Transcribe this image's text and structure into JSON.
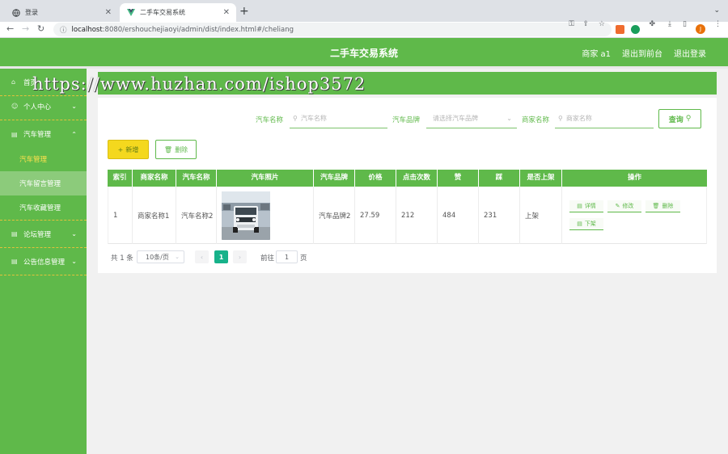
{
  "browser": {
    "tabs": [
      {
        "title": "登录",
        "icon": "globe-icon"
      },
      {
        "title": "二手车交易系统",
        "icon": "vue-logo-icon"
      }
    ],
    "url_host": "localhost",
    "url_path": ":8080/ershouchejiaoyi/admin/dist/index.html#/cheliang",
    "profile_initial": "J"
  },
  "header": {
    "title": "二手车交易系统",
    "nav": [
      "商家 a1",
      "退出到前台",
      "退出登录"
    ]
  },
  "watermark": "https://www.huzhan.com/ishop3572",
  "sidebar": {
    "items": [
      {
        "label": "首页",
        "icon": "home-icon"
      },
      {
        "label": "个人中心",
        "icon": "user-icon"
      },
      {
        "label": "汽车管理",
        "icon": "car-icon"
      },
      {
        "label": "论坛管理",
        "icon": "forum-icon"
      },
      {
        "label": "公告信息管理",
        "icon": "notice-icon"
      }
    ],
    "subitems": [
      "汽车管理",
      "汽车留言管理",
      "汽车收藏管理"
    ]
  },
  "search": {
    "car_name_label": "汽车名称",
    "car_name_placeholder": "汽车名称",
    "brand_label": "汽车品牌",
    "brand_placeholder": "请选择汽车品牌",
    "merchant_label": "商家名称",
    "merchant_placeholder": "商家名称",
    "query_button": "查询"
  },
  "actions": {
    "add": "新增",
    "delete": "删除"
  },
  "table": {
    "columns": [
      "索引",
      "商家名称",
      "汽车名称",
      "汽车照片",
      "汽车品牌",
      "价格",
      "点击次数",
      "赞",
      "踩",
      "是否上架",
      "操作"
    ],
    "rows": [
      {
        "index": "1",
        "merchant": "商家名称1",
        "car_name": "汽车名称2",
        "brand": "汽车品牌2",
        "price": "27.59",
        "clicks": "212",
        "likes": "484",
        "dislikes": "231",
        "status": "上架"
      }
    ],
    "row_actions": [
      "详情",
      "修改",
      "删除",
      "下架"
    ]
  },
  "pagination": {
    "total": "共 1 条",
    "page_size": "10条/页",
    "current_page": "1",
    "goto_label": "前往",
    "goto_value": "1",
    "page_suffix": "页"
  },
  "colors": {
    "primary_green": "#5fb94a",
    "add_yellow": "#f4d81e",
    "page_active": "#17b28a"
  }
}
